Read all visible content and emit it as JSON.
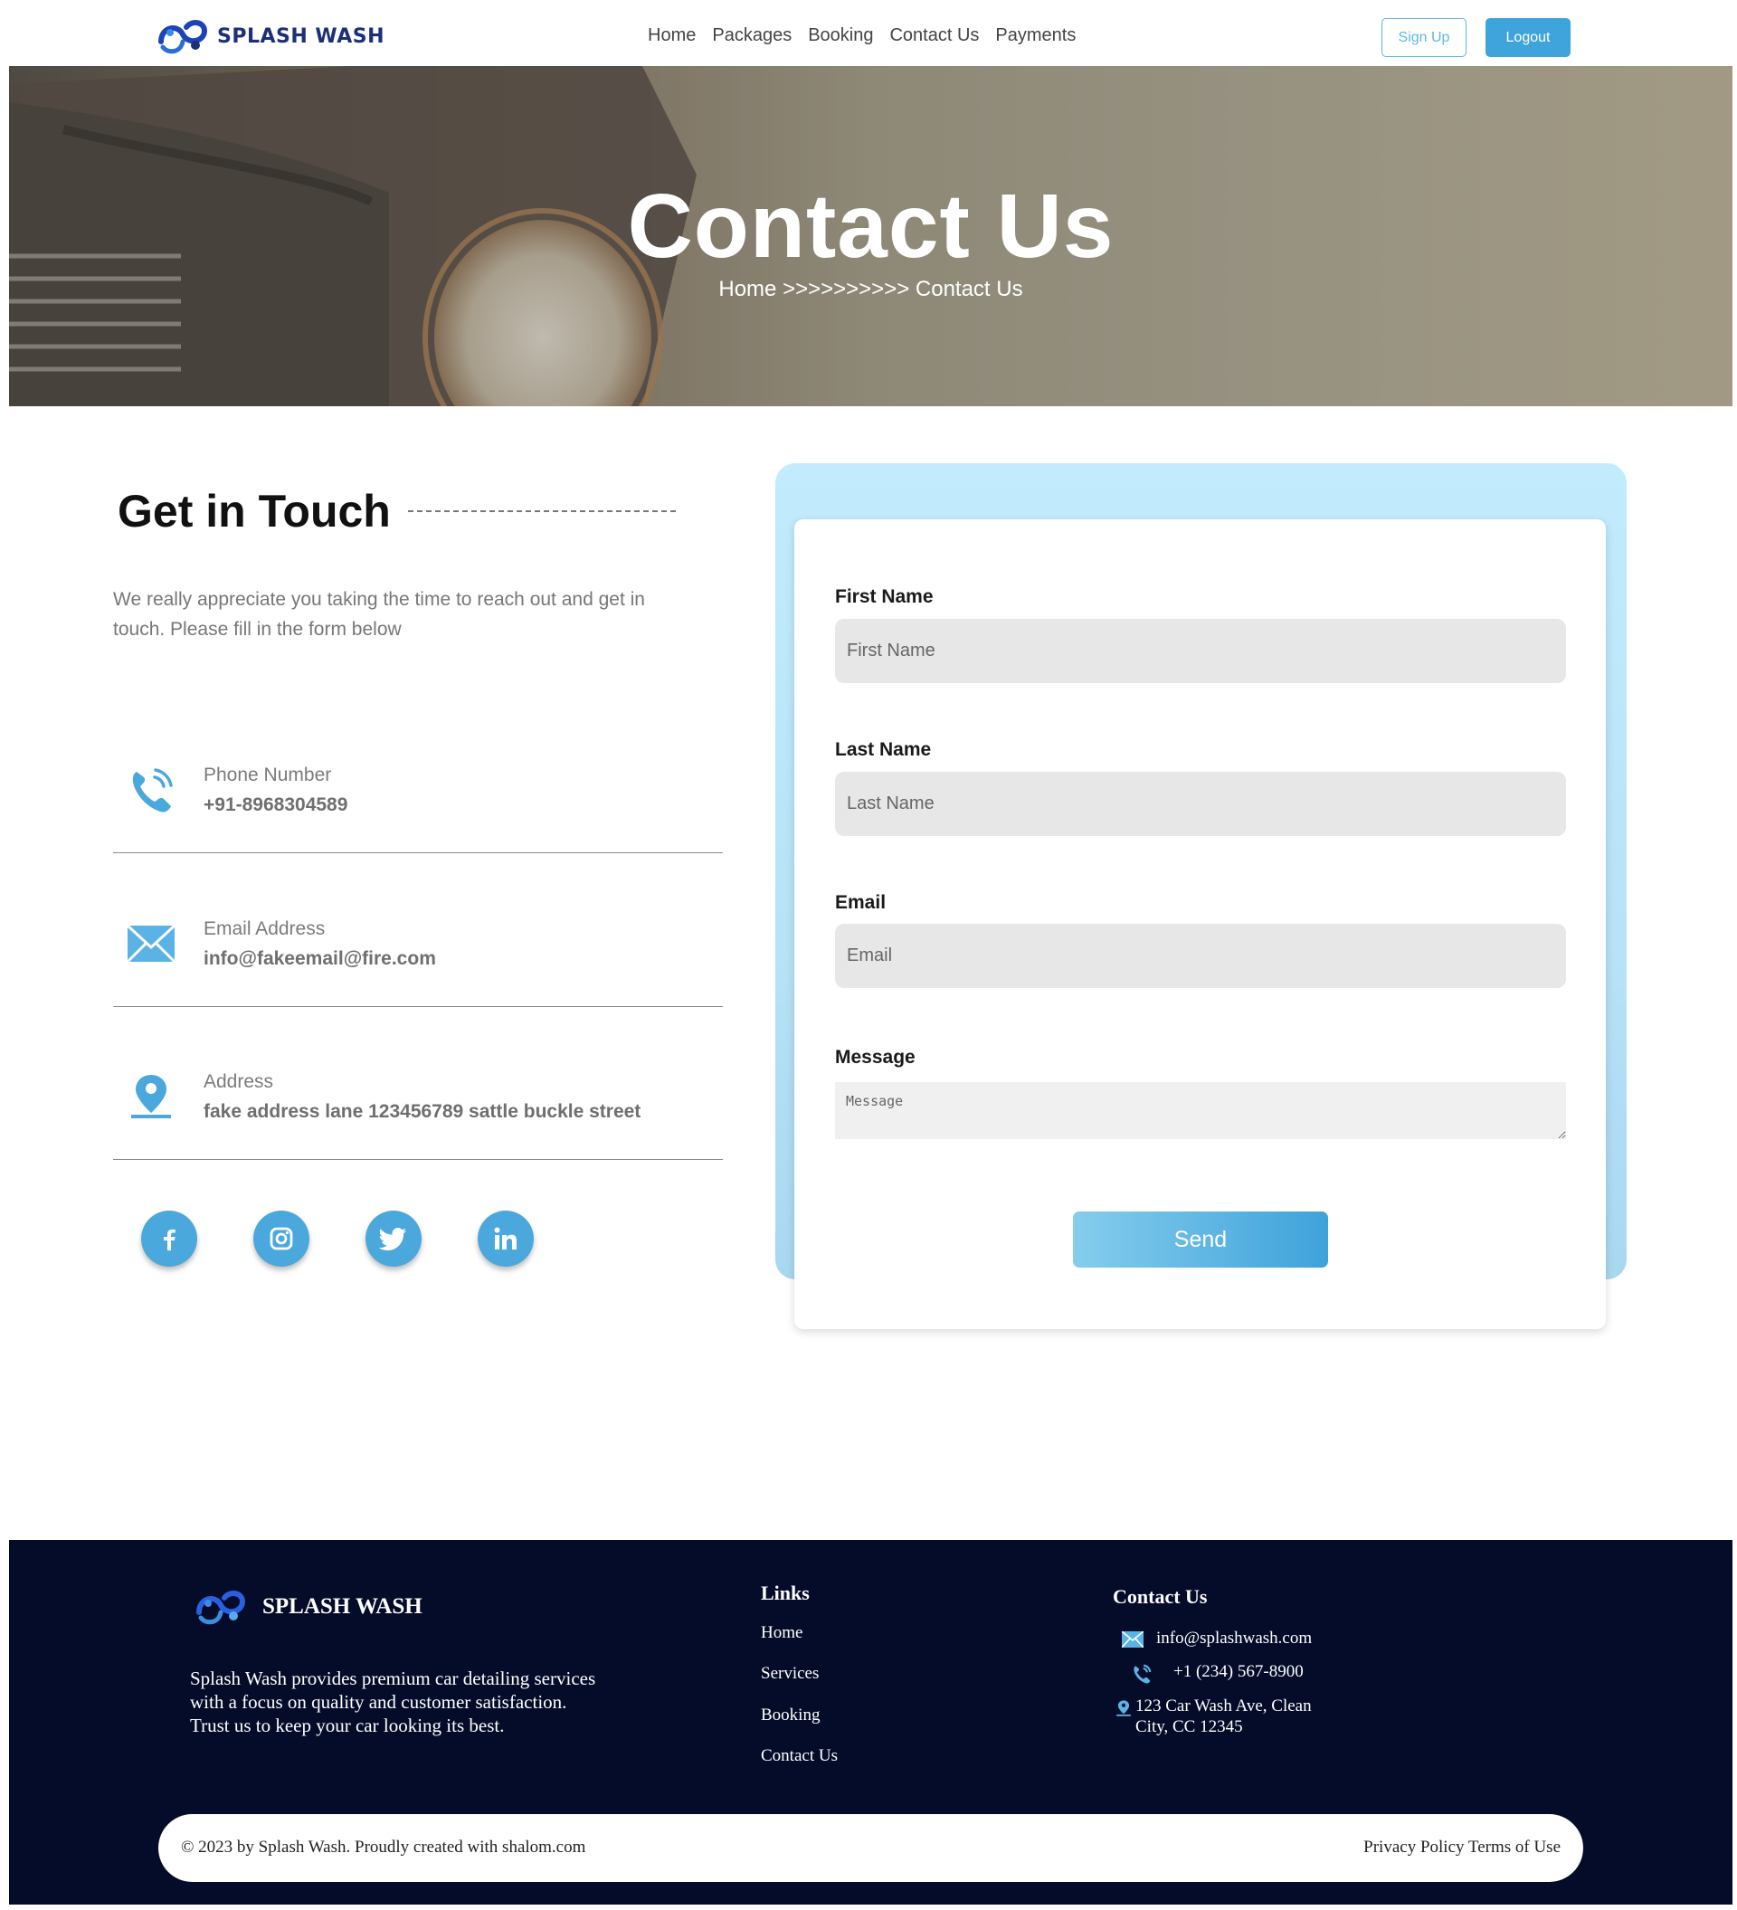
{
  "nav": {
    "brand": "SPLASH WASH",
    "links": [
      "Home",
      "Packages",
      "Booking",
      "Contact Us",
      "Payments"
    ],
    "signup_label": "Sign Up",
    "logout_label": "Logout"
  },
  "hero": {
    "title": "Contact Us",
    "breadcrumb": "Home >>>>>>>>>> Contact Us"
  },
  "intro": {
    "heading": "Get in Touch",
    "description": "We really appreciate you taking the time to reach out and get in touch. Please fill in the form below"
  },
  "contact_info": [
    {
      "icon": "phone-icon",
      "label": "Phone Number",
      "value": "+91-8968304589"
    },
    {
      "icon": "envelope-icon",
      "label": "Email Address",
      "value": "info@fakeemail@fire.com"
    },
    {
      "icon": "location-pin-icon",
      "label": "Address",
      "value": "fake address lane 123456789 sattle buckle street"
    }
  ],
  "socials": [
    "facebook-icon",
    "instagram-icon",
    "twitter-icon",
    "linkedin-icon"
  ],
  "form": {
    "first_name": {
      "label": "First Name",
      "placeholder": "First Name"
    },
    "last_name": {
      "label": "Last Name",
      "placeholder": "Last Name"
    },
    "email": {
      "label": "Email",
      "placeholder": "Email"
    },
    "message": {
      "label": "Message",
      "placeholder": "Message"
    },
    "submit_label": "Send"
  },
  "footer": {
    "brand": "SPLASH WASH",
    "description": "Splash Wash provides premium car detailing services with a focus on quality and customer satisfaction. Trust us to keep your car looking its best.",
    "links_heading": "Links",
    "links": [
      "Home",
      "Services",
      "Booking",
      "Contact Us"
    ],
    "contact_heading": "Contact Us",
    "email": "info@splashwash.com",
    "phone": "+1 (234) 567-8900",
    "address_line1": "123 Car Wash Ave, Clean",
    "address_line2": "City, CC 12345",
    "copyright": "© 2023 by Splash Wash. Proudly created with shalom.com",
    "legal": "Privacy Policy Terms of Use"
  },
  "colors": {
    "accent": "#3fa3dc",
    "brand_navy": "#1b2f7a",
    "footer_bg": "#050c2a",
    "form_bg": "#c2ecfd"
  }
}
